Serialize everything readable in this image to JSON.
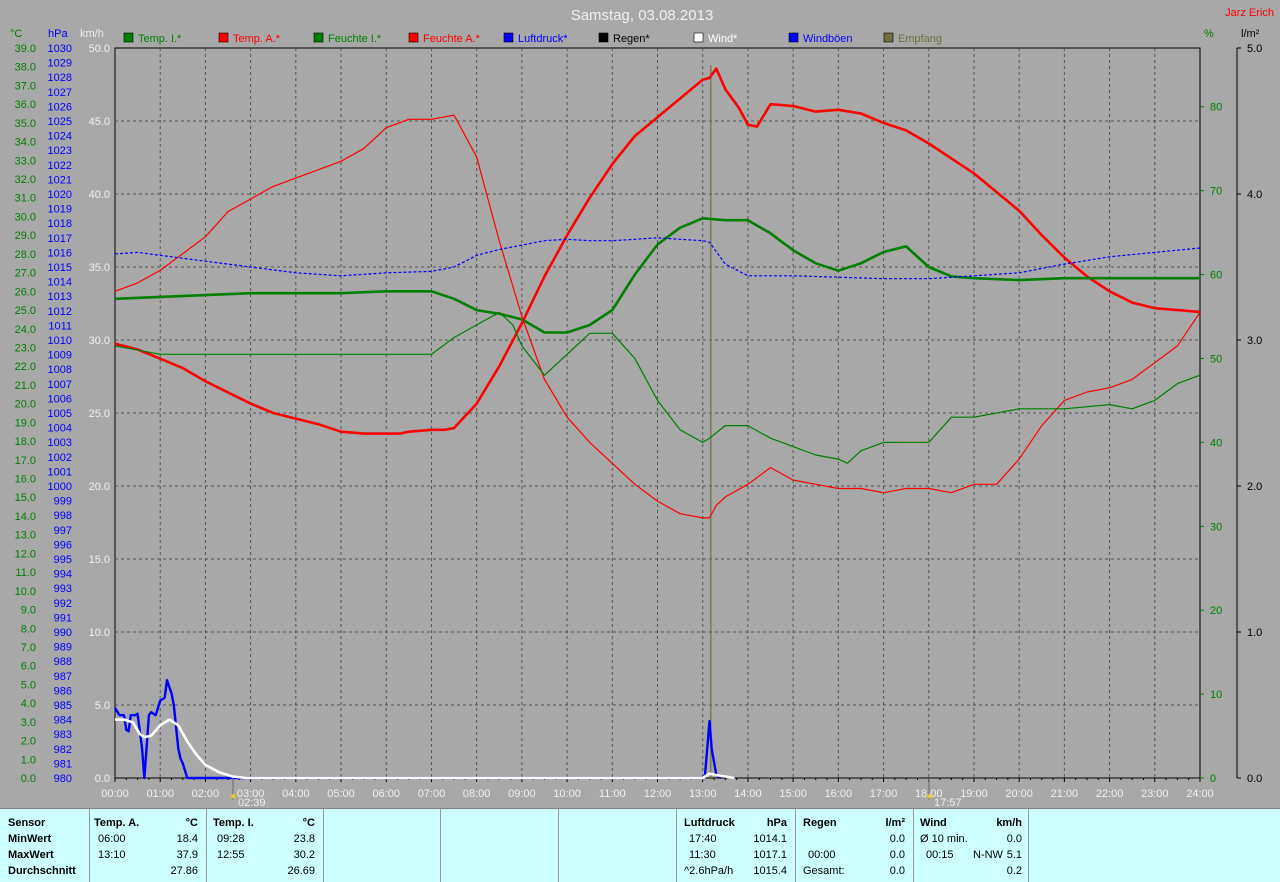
{
  "header": {
    "title": "Samstag, 03.08.2013",
    "author": "Jarz Erich"
  },
  "axis_units": {
    "temp": "°C",
    "pressure": "hPa",
    "wind": "km/h",
    "humidity": "%",
    "rain": "l/m²"
  },
  "legend": [
    {
      "label": "Temp. I.*",
      "color": "#007f00"
    },
    {
      "label": "Temp. A.*",
      "color": "#ff0000"
    },
    {
      "label": "Feuchte I.*",
      "color": "#007f00"
    },
    {
      "label": "Feuchte A.*",
      "color": "#ff0000"
    },
    {
      "label": "Luftdruck*",
      "color": "#0000ff"
    },
    {
      "label": "Regen*",
      "color": "#000000"
    },
    {
      "label": "Wind*",
      "color": "#ffffff"
    },
    {
      "label": "Windböen",
      "color": "#0000ff"
    },
    {
      "label": "Empfang",
      "color": "#6f6f3f"
    }
  ],
  "markers": {
    "sunrise": "02:39",
    "sunset": "17:57"
  },
  "chart_data": {
    "type": "line",
    "title": "Samstag, 03.08.2013",
    "x_unit": "hours",
    "xlim": [
      0,
      24
    ],
    "x_ticks": [
      "00:00",
      "01:00",
      "02:00",
      "03:00",
      "04:00",
      "05:00",
      "06:00",
      "07:00",
      "08:00",
      "09:00",
      "10:00",
      "11:00",
      "12:00",
      "13:00",
      "14:00",
      "15:00",
      "16:00",
      "17:00",
      "18:00",
      "19:00",
      "20:00",
      "21:00",
      "22:00",
      "23:00",
      "24:00"
    ],
    "axes": {
      "temp_c": {
        "range": [
          0,
          39
        ],
        "ticks": [
          "0.0",
          "1.0",
          "2.0",
          "3.0",
          "4.0",
          "5.0",
          "6.0",
          "7.0",
          "8.0",
          "9.0",
          "10.0",
          "11.0",
          "12.0",
          "13.0",
          "14.0",
          "15.0",
          "16.0",
          "17.0",
          "18.0",
          "19.0",
          "20.0",
          "21.0",
          "22.0",
          "23.0",
          "24.0",
          "25.0",
          "26.0",
          "27.0",
          "28.0",
          "29.0",
          "30.0",
          "31.0",
          "32.0",
          "33.0",
          "34.0",
          "35.0",
          "36.0",
          "37.0",
          "38.0",
          "39.0"
        ]
      },
      "pressure_hpa": {
        "range": [
          980,
          1030
        ],
        "ticks": [
          "980",
          "981",
          "982",
          "983",
          "984",
          "985",
          "986",
          "987",
          "988",
          "989",
          "990",
          "991",
          "992",
          "993",
          "994",
          "995",
          "996",
          "997",
          "998",
          "999",
          "1000",
          "1001",
          "1002",
          "1003",
          "1004",
          "1005",
          "1006",
          "1007",
          "1008",
          "1009",
          "1010",
          "1011",
          "1012",
          "1013",
          "1014",
          "1015",
          "1016",
          "1017",
          "1018",
          "1019",
          "1020",
          "1021",
          "1022",
          "1023",
          "1024",
          "1025",
          "1026",
          "1027",
          "1028",
          "1029",
          "1030"
        ]
      },
      "wind_kmh": {
        "range": [
          0,
          50
        ],
        "ticks": [
          "0.0",
          "5.0",
          "10.0",
          "15.0",
          "20.0",
          "25.0",
          "30.0",
          "35.0",
          "40.0",
          "45.0",
          "50.0"
        ]
      },
      "humidity_pct": {
        "range": [
          0,
          87
        ],
        "ticks": [
          "0",
          "10",
          "20",
          "30",
          "40",
          "50",
          "60",
          "70",
          "80"
        ]
      },
      "rain_lm2": {
        "range": [
          0,
          5
        ],
        "ticks": [
          "0.0",
          "1.0",
          "2.0",
          "3.0",
          "4.0",
          "5.0"
        ]
      }
    },
    "grid": true,
    "series": [
      {
        "name": "Temp. A.*",
        "axis": "temp_c",
        "color": "#ff0000",
        "width": 2.6,
        "x": [
          0,
          0.5,
          1,
          1.5,
          2,
          2.5,
          3,
          3.5,
          4,
          4.5,
          5,
          5.5,
          6,
          6.3,
          6.5,
          7,
          7.3,
          7.5,
          8,
          8.5,
          9,
          9.5,
          10,
          10.5,
          11,
          11.5,
          12,
          12.5,
          13,
          13.15,
          13.3,
          13.5,
          13.8,
          14,
          14.2,
          14.5,
          15,
          15.5,
          16,
          16.5,
          17,
          17.5,
          18,
          18.5,
          19,
          19.5,
          20,
          20.5,
          21,
          21.5,
          22,
          22.5,
          23,
          23.5,
          24
        ],
        "y": [
          23.2,
          22.9,
          22.4,
          21.9,
          21.2,
          20.6,
          20.0,
          19.5,
          19.2,
          18.9,
          18.5,
          18.4,
          18.4,
          18.4,
          18.5,
          18.6,
          18.6,
          18.7,
          20.0,
          22.0,
          24.3,
          26.8,
          29.0,
          31.0,
          32.8,
          34.3,
          35.3,
          36.3,
          37.3,
          37.4,
          37.9,
          36.8,
          35.8,
          34.9,
          34.8,
          36.0,
          35.9,
          35.6,
          35.7,
          35.5,
          35.0,
          34.6,
          33.9,
          33.1,
          32.3,
          31.3,
          30.3,
          29.0,
          27.8,
          26.8,
          26.0,
          25.4,
          25.1,
          25.0,
          24.9
        ]
      },
      {
        "name": "Temp. I.*",
        "axis": "temp_c",
        "color": "#007f00",
        "width": 2.6,
        "x": [
          0,
          1,
          2,
          3,
          4,
          5,
          6,
          7,
          7.5,
          8,
          8.5,
          9,
          9.5,
          10,
          10.5,
          11,
          11.5,
          12,
          12.5,
          13,
          13.5,
          14,
          14.5,
          15,
          15.5,
          16,
          16.5,
          17,
          17.5,
          18,
          18.5,
          19,
          20,
          21,
          22,
          23,
          24
        ],
        "y": [
          25.6,
          25.7,
          25.8,
          25.9,
          25.9,
          25.9,
          26.0,
          26.0,
          25.6,
          25.0,
          24.8,
          24.5,
          23.8,
          23.8,
          24.2,
          25.0,
          26.9,
          28.5,
          29.4,
          29.9,
          29.8,
          29.8,
          29.1,
          28.2,
          27.5,
          27.1,
          27.5,
          28.1,
          28.4,
          27.3,
          26.8,
          26.7,
          26.6,
          26.7,
          26.7,
          26.7,
          26.7
        ]
      },
      {
        "name": "Feuchte A.*",
        "axis": "humidity_pct",
        "color": "#ff0000",
        "width": 1.2,
        "x": [
          0,
          0.5,
          1,
          1.5,
          2,
          2.5,
          3,
          3.5,
          4,
          4.5,
          5,
          5.5,
          6,
          6.5,
          7,
          7.5,
          8,
          8.5,
          9,
          9.5,
          10,
          10.5,
          11,
          11.5,
          12,
          12.5,
          13,
          13.15,
          13.3,
          13.5,
          14,
          14.5,
          15,
          15.5,
          16,
          16.5,
          17,
          17.5,
          18,
          18.5,
          19,
          19.5,
          20,
          20.5,
          21,
          21.5,
          22,
          22.5,
          23,
          23.5,
          24
        ],
        "y": [
          58,
          59,
          60.5,
          62.5,
          64.5,
          67.5,
          69,
          70.5,
          71.5,
          72.5,
          73.5,
          75,
          77.5,
          78.5,
          78.5,
          79,
          74,
          64,
          55,
          47.5,
          43,
          40,
          37.5,
          35,
          33,
          31.5,
          31,
          31,
          32.5,
          33.5,
          35,
          37,
          35.5,
          35,
          34.5,
          34.5,
          34,
          34.5,
          34.5,
          34,
          35,
          35,
          38,
          42,
          45,
          46,
          46.5,
          47.5,
          49.5,
          51.5,
          55.5
        ]
      },
      {
        "name": "Feuchte I.*",
        "axis": "humidity_pct",
        "color": "#007f00",
        "width": 1.2,
        "x": [
          0,
          1,
          2,
          3,
          4,
          5,
          6,
          7,
          7.5,
          8,
          8.5,
          8.8,
          9,
          9.5,
          10,
          10.5,
          11,
          11.5,
          12,
          12.5,
          13,
          13.15,
          13.5,
          14,
          14.5,
          15,
          15.5,
          16,
          16.2,
          16.5,
          17,
          17.5,
          18,
          18.5,
          19,
          20,
          21,
          22,
          22.5,
          23,
          23.5,
          24
        ],
        "y": [
          51.5,
          50.5,
          50.5,
          50.5,
          50.5,
          50.5,
          50.5,
          50.5,
          52.5,
          54,
          55.5,
          54,
          51.5,
          48,
          50.5,
          53,
          53,
          50,
          45,
          41.5,
          40,
          40.5,
          42,
          42,
          40.5,
          39.5,
          38.5,
          38,
          37.5,
          39,
          40,
          40,
          40,
          43,
          43,
          44,
          44,
          44.5,
          44,
          45,
          47,
          48
        ]
      },
      {
        "name": "Luftdruck*",
        "axis": "pressure_hpa",
        "color": "#0000ff",
        "width": 1.2,
        "dash": "3,2",
        "x": [
          0,
          0.5,
          1,
          2,
          3,
          4,
          5,
          6,
          7,
          7.5,
          8,
          8.5,
          9,
          9.5,
          10,
          10.5,
          11,
          11.5,
          12,
          12.5,
          13,
          13.15,
          13.5,
          14,
          14.5,
          15,
          16,
          17,
          18,
          19,
          20,
          21,
          22,
          23,
          24
        ],
        "y": [
          1015.9,
          1016.0,
          1015.8,
          1015.4,
          1015.0,
          1014.6,
          1014.4,
          1014.6,
          1014.7,
          1015.0,
          1015.8,
          1016.2,
          1016.5,
          1016.8,
          1016.9,
          1016.8,
          1016.8,
          1016.9,
          1017.0,
          1016.9,
          1016.8,
          1016.7,
          1015.2,
          1014.4,
          1014.4,
          1014.4,
          1014.3,
          1014.2,
          1014.2,
          1014.4,
          1014.6,
          1015.2,
          1015.7,
          1016.0,
          1016.3
        ]
      },
      {
        "name": "Windböen",
        "axis": "wind_kmh",
        "color": "#0000ff",
        "width": 2.4,
        "x": [
          0,
          0.1,
          0.2,
          0.25,
          0.3,
          0.35,
          0.45,
          0.5,
          0.6,
          0.65,
          0.75,
          0.8,
          0.9,
          1.0,
          1.1,
          1.15,
          1.25,
          1.3,
          1.4,
          1.45,
          1.5,
          1.6,
          1.7,
          13.0,
          13.05,
          13.1,
          13.15,
          13.2,
          13.3,
          13.4
        ],
        "y": [
          4.8,
          4.3,
          4.3,
          3.3,
          3.2,
          4.3,
          4.3,
          4.4,
          2.0,
          0,
          4.3,
          4.5,
          4.3,
          5.3,
          5.5,
          6.7,
          5.8,
          5.0,
          2.0,
          1.3,
          1.0,
          0,
          0,
          0,
          0.2,
          2.0,
          3.9,
          2.0,
          0.2,
          0
        ]
      },
      {
        "name": "Wind*",
        "axis": "wind_kmh",
        "color": "#ffffff",
        "width": 2.6,
        "x": [
          0,
          0.2,
          0.4,
          0.55,
          0.65,
          0.8,
          1.0,
          1.2,
          1.4,
          1.6,
          1.8,
          2.0,
          2.3,
          2.6,
          2.9,
          13.0,
          13.05,
          13.15,
          13.3,
          13.5,
          13.7
        ],
        "y": [
          4.0,
          4.0,
          3.8,
          3.0,
          2.8,
          2.9,
          3.6,
          4.0,
          3.6,
          2.5,
          1.6,
          0.9,
          0.4,
          0.1,
          0,
          0,
          0.1,
          0.3,
          0.2,
          0.1,
          0
        ]
      }
    ]
  },
  "footer": {
    "sensor_col": {
      "header": "Sensor",
      "rows": [
        "MinWert",
        "MaxWert",
        "Durchschnitt"
      ]
    },
    "temp_a": {
      "header": "Temp. A.",
      "unit": "°C",
      "min_time": "06:00",
      "min_val": "18.4",
      "max_time": "13:10",
      "max_val": "37.9",
      "avg": "27.86"
    },
    "temp_i": {
      "header": "Temp. I.",
      "unit": "°C",
      "min_time": "09:28",
      "min_val": "23.8",
      "max_time": "12:55",
      "max_val": "30.2",
      "avg": "26.69"
    },
    "pressure": {
      "header": "Luftdruck",
      "unit": "hPa",
      "min_time": "17:40",
      "min_val": "1014.1",
      "max_time": "11:30",
      "max_val": "1017.1",
      "trend": "^2.6hPa/h",
      "avg": "1015.4"
    },
    "rain": {
      "header": "Regen",
      "unit": "l/m²",
      "time": "00:00",
      "val": "0.0",
      "val2": "0.0",
      "total_label": "Gesamt:",
      "total": "0.0"
    },
    "wind": {
      "header": "Wind",
      "unit": "km/h",
      "avg_label": "Ø 10 min.",
      "avg_val": "0.0",
      "gust_time": "00:15",
      "gust_dir": "N-NW",
      "gust_val": "5.1",
      "day_avg": "0.2"
    }
  }
}
